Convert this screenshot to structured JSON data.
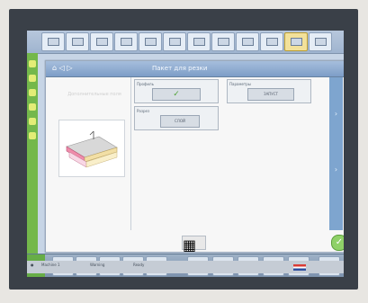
{
  "screen": {
    "dialog_title": "Пакет для резки",
    "nav_label": "⌂ ◁ ▷",
    "left_panel_label": "Дополнительные поля",
    "cards": [
      {
        "title": "Профиль",
        "button": "✓"
      },
      {
        "title": "Параметры",
        "button": "ЗАПУСТ"
      },
      {
        "title": "Разрез",
        "button": "СЛОЙ"
      }
    ],
    "bottom_button": "▦",
    "ok_button": "✓"
  },
  "status": {
    "items": [
      "●",
      "Machine 1",
      "Warning",
      "Ready"
    ]
  },
  "colors": {
    "accent_green": "#74b84b",
    "title_blue": "#7d9dc7",
    "scroll_blue": "#7ea5cf"
  }
}
